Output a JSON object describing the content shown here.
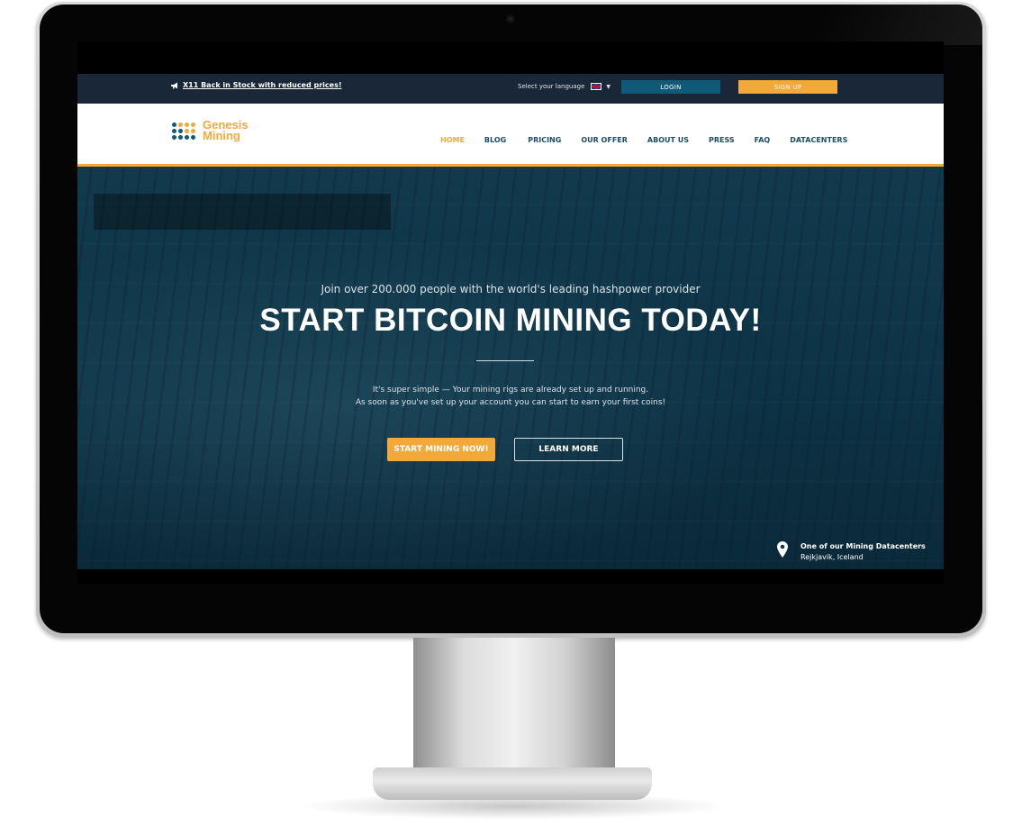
{
  "topbar": {
    "notice": "X11 Back in Stock with reduced prices!",
    "language_label": "Select your language",
    "login_label": "LOGIN",
    "signup_label": "SIGN UP"
  },
  "header": {
    "logo_line1": "Genesis",
    "logo_line2": "Mining",
    "nav": [
      "HOME",
      "BLOG",
      "PRICING",
      "OUR OFFER",
      "ABOUT US",
      "PRESS",
      "FAQ",
      "DATACENTERS"
    ],
    "active_nav": "HOME"
  },
  "hero": {
    "subheading": "Join over 200.000 people with the world's leading hashpower provider",
    "title": "START BITCOIN MINING TODAY!",
    "description_line1": "It's super simple — Your mining rigs are already set up and running.",
    "description_line2": "As soon as you've set up your account you can start to earn your first coins!",
    "start_button": "START MINING NOW!",
    "learn_button": "LEARN MORE",
    "location_title": "One of our Mining Datacenters",
    "location_place": "Rejkjavik, Iceland"
  },
  "colors": {
    "accent": "#f3a93a",
    "brand_blue": "#0f5a76",
    "topbar": "#1a2738",
    "nav_text": "#1a4d6b"
  }
}
